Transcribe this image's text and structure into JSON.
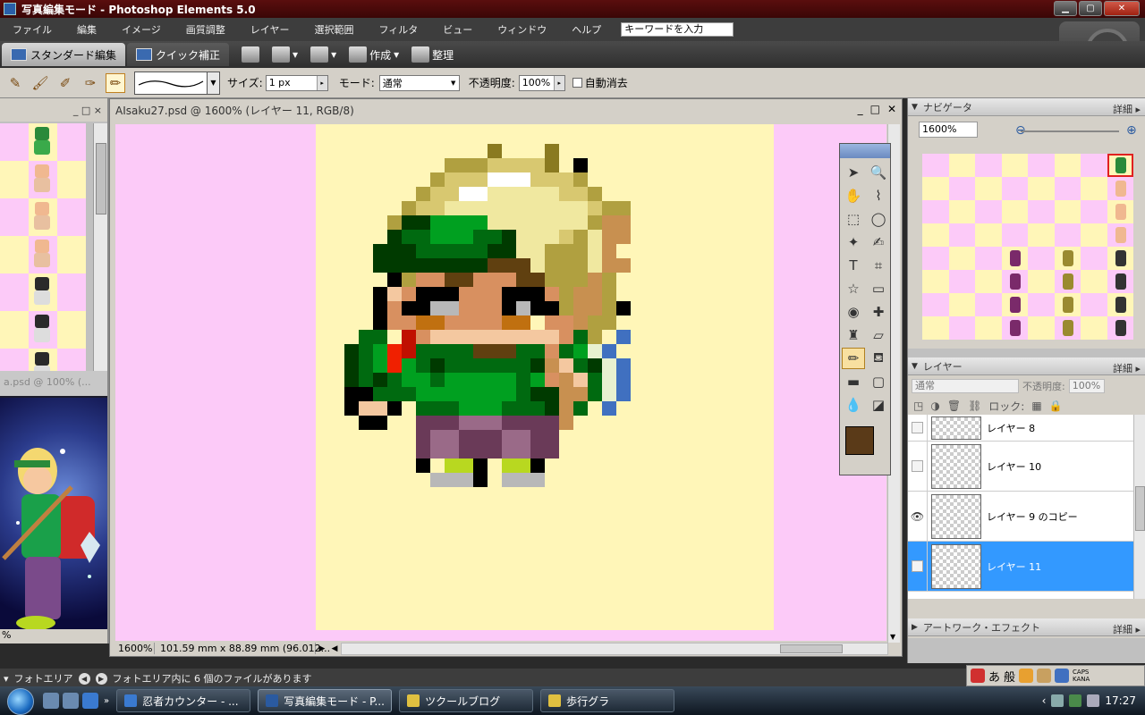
{
  "window": {
    "title": "写真編集モード - Photoshop Elements 5.0",
    "buttons": [
      "minimize",
      "maximize",
      "close"
    ]
  },
  "menu": {
    "items": [
      "ファイル",
      "編集",
      "イメージ",
      "画質調整",
      "レイヤー",
      "選択範囲",
      "フィルタ",
      "ビュー",
      "ウィンドウ",
      "ヘルプ"
    ],
    "search_placeholder": "キーワードを入力"
  },
  "modebar": {
    "standard_tab": "スタンダード編集",
    "quick_tab": "クイック補正",
    "create_label": "作成",
    "organize_label": "整理"
  },
  "options": {
    "size_label": "サイズ:",
    "size_value": "1 px",
    "mode_label": "モード:",
    "mode_value": "通常",
    "opacity_label": "不透明度:",
    "opacity_value": "100%",
    "auto_erase_label": "自動消去"
  },
  "photobin_header": "_ □ ×",
  "artwin": {
    "title": "a.psd @ 100% (...",
    "footer": "%"
  },
  "document": {
    "title": "AIsaku27.psd @ 1600% (レイヤー 11, RGB/8)",
    "status_zoom": "1600%",
    "status_info": "101.59 mm x 88.89 mm (96.012..."
  },
  "navigator": {
    "title": "ナビゲータ",
    "more": "詳細",
    "zoom_value": "1600%"
  },
  "layers": {
    "title": "レイヤー",
    "more": "詳細",
    "mode_value": "通常",
    "opacity_label": "不透明度:",
    "opacity_value": "100%",
    "lock_label": "ロック:",
    "items": [
      {
        "name": "レイヤー 8",
        "visible": false,
        "selected": false
      },
      {
        "name": "レイヤー 10",
        "visible": false,
        "selected": false
      },
      {
        "name": "レイヤー 9 のコピー",
        "visible": true,
        "selected": false
      },
      {
        "name": "レイヤー 11",
        "visible": false,
        "selected": true
      }
    ]
  },
  "artwork_panel": {
    "title": "アートワーク・エフェクト",
    "more": "詳細"
  },
  "photobin_bar": {
    "label": "フォトエリア",
    "message": "フォトエリア内に 6 個のファイルがあります"
  },
  "ime": {
    "mode": "あ",
    "label": "般",
    "caps": "CAPS",
    "kana": "KANA"
  },
  "taskbar": {
    "tasks": [
      {
        "label": "忍者カウンター - ...",
        "active": false
      },
      {
        "label": "写真編集モード - P...",
        "active": true
      },
      {
        "label": "ツクールブログ",
        "active": false
      },
      {
        "label": "歩行グラ",
        "active": false
      }
    ],
    "clock": "17:27"
  },
  "colors": {
    "canvas_pink": "#fccaf8",
    "canvas_yellow": "#fff6b8",
    "foreground": "#5a3a18",
    "selection_blue": "#3399ff"
  }
}
